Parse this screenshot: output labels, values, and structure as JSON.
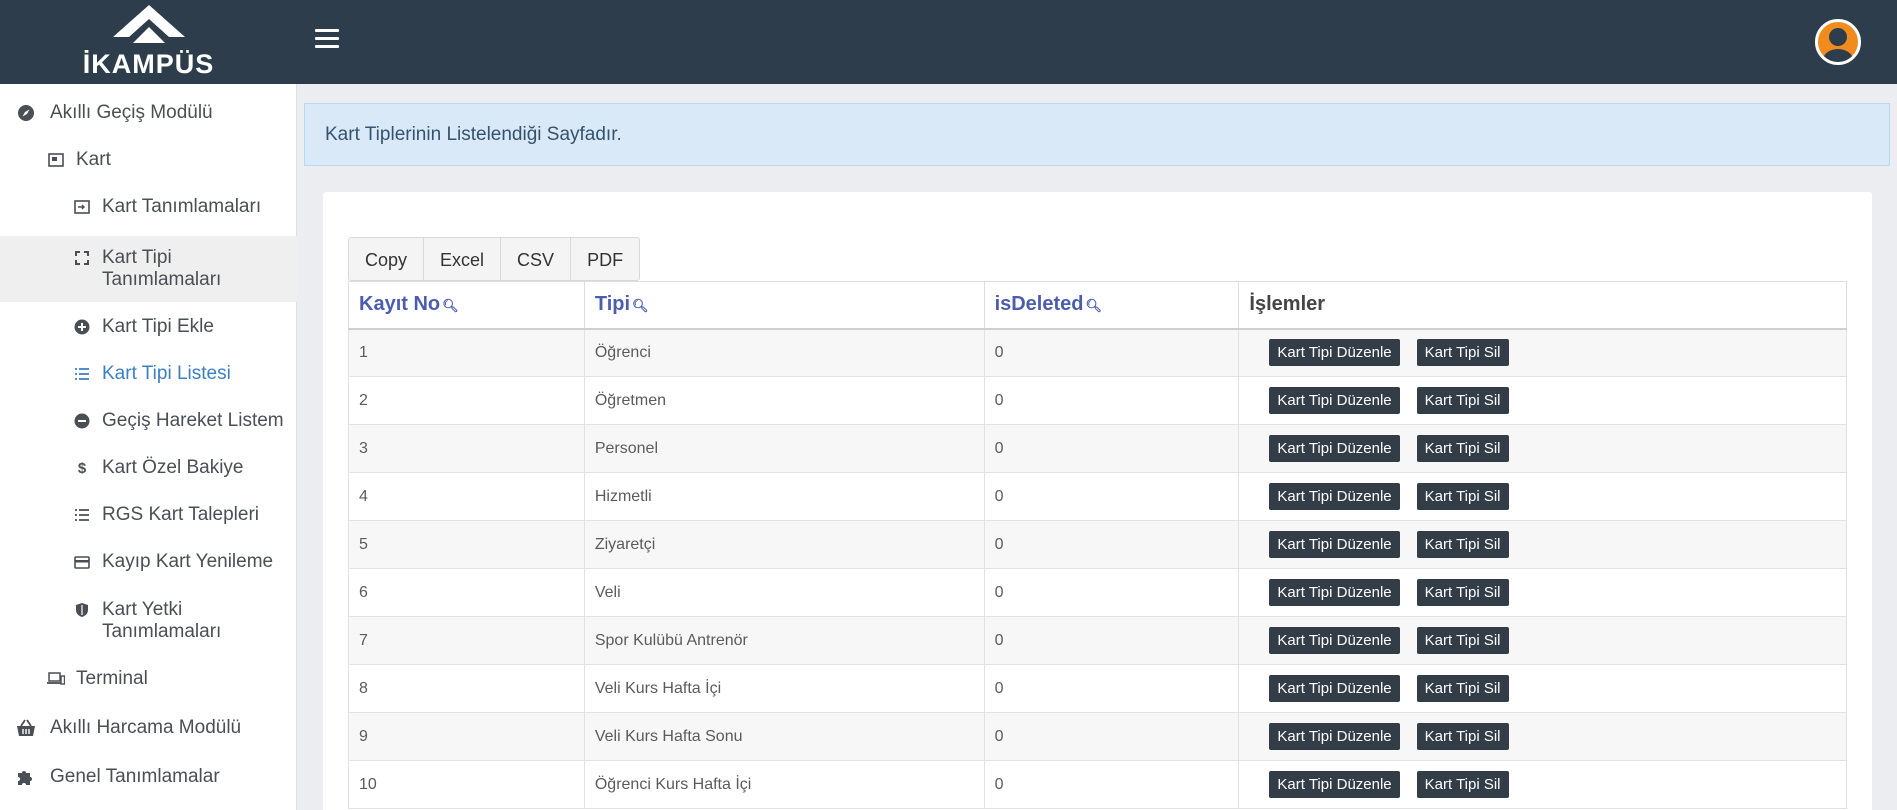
{
  "brand": {
    "name": "İKAMPÜS"
  },
  "sidebar": {
    "items": [
      {
        "label": "Akıllı Geçiş Modülü",
        "icon": "compass-icon"
      },
      {
        "label": "Kart",
        "icon": "id-card-icon"
      },
      {
        "label": "Kart Tanımlamaları",
        "icon": "card-arrow-icon"
      },
      {
        "label": "Kart Tipi Tanımlamaları",
        "icon": "expand-icon"
      },
      {
        "label": "Kart Tipi Ekle",
        "icon": "plus-circle-icon"
      },
      {
        "label": "Kart Tipi Listesi",
        "icon": "list-icon"
      },
      {
        "label": "Geçiş Hareket Listem",
        "icon": "minus-circle-icon"
      },
      {
        "label": "Kart Özel Bakiye",
        "icon": "dollar-icon"
      },
      {
        "label": "RGS Kart Talepleri",
        "icon": "list-icon"
      },
      {
        "label": "Kayıp Kart Yenileme",
        "icon": "credit-card-icon"
      },
      {
        "label": "Kart Yetki Tanımlamaları",
        "icon": "shield-icon"
      },
      {
        "label": "Terminal",
        "icon": "devices-icon"
      },
      {
        "label": "Akıllı Harcama Modülü",
        "icon": "basket-icon"
      },
      {
        "label": "Genel Tanımlamalar",
        "icon": "puzzle-icon"
      }
    ]
  },
  "alert": {
    "text": "Kart Tiplerinin Listelendiği Sayfadır."
  },
  "export_buttons": [
    "Copy",
    "Excel",
    "CSV",
    "PDF"
  ],
  "table": {
    "headers": [
      "Kayıt No",
      "Tipi",
      "isDeleted",
      "İşlemler"
    ],
    "edit_label": "Kart Tipi Düzenle",
    "delete_label": "Kart Tipi Sil",
    "rows": [
      {
        "no": "1",
        "tipi": "Öğrenci",
        "deleted": "0"
      },
      {
        "no": "2",
        "tipi": "Öğretmen",
        "deleted": "0"
      },
      {
        "no": "3",
        "tipi": "Personel",
        "deleted": "0"
      },
      {
        "no": "4",
        "tipi": "Hizmetli",
        "deleted": "0"
      },
      {
        "no": "5",
        "tipi": "Ziyaretçi",
        "deleted": "0"
      },
      {
        "no": "6",
        "tipi": "Veli",
        "deleted": "0"
      },
      {
        "no": "7",
        "tipi": "Spor Kulübü Antrenör",
        "deleted": "0"
      },
      {
        "no": "8",
        "tipi": "Veli Kurs Hafta İçi",
        "deleted": "0"
      },
      {
        "no": "9",
        "tipi": "Veli Kurs Hafta Sonu",
        "deleted": "0"
      },
      {
        "no": "10",
        "tipi": "Öğrenci Kurs Hafta İçi",
        "deleted": "0"
      }
    ]
  }
}
